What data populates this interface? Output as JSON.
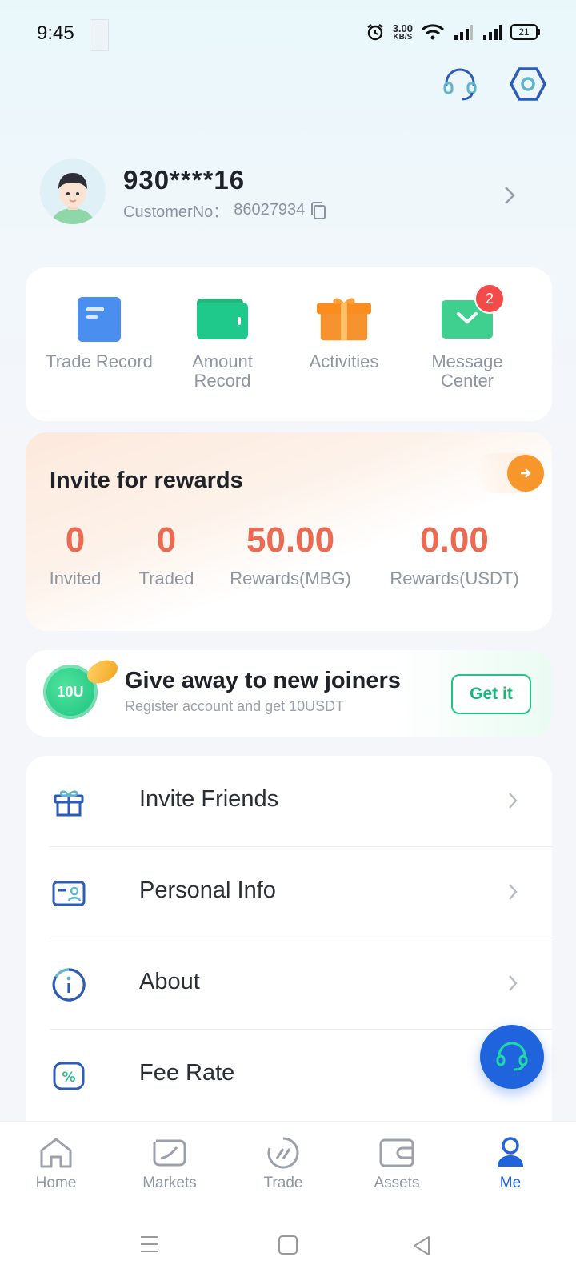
{
  "status_bar": {
    "time": "9:45",
    "net_speed_value": "3.00",
    "net_speed_unit": "KB/S",
    "battery": "21"
  },
  "header": {
    "support_icon": "headset-icon",
    "settings_icon": "hexagon-settings-icon"
  },
  "profile": {
    "username": "930****16",
    "customer_no_label": "CustomerNo：",
    "customer_no": "86027934"
  },
  "quick_actions": [
    {
      "label": "Trade Record",
      "icon": "document-icon",
      "color": "#4a8ff0"
    },
    {
      "label": "Amount Record",
      "icon": "wallet-icon",
      "color": "#1fc98b"
    },
    {
      "label": "Activities",
      "icon": "gift-icon",
      "color": "#f7932e"
    },
    {
      "label": "Message Center",
      "icon": "envelope-icon",
      "color": "#3fcf8e",
      "badge": "2"
    }
  ],
  "invite_rewards": {
    "title": "Invite for rewards",
    "stats": [
      {
        "value": "0",
        "label": "Invited"
      },
      {
        "value": "0",
        "label": "Traded"
      },
      {
        "value": "50.00",
        "label": "Rewards(MBG)"
      },
      {
        "value": "0.00",
        "label": "Rewards(USDT)"
      }
    ]
  },
  "new_joiners": {
    "coin_text": "10U",
    "title": "Give away to new joiners",
    "subtitle": "Register account  and get 10USDT",
    "button": "Get it"
  },
  "menu": [
    {
      "label": "Invite Friends",
      "icon": "gift-box-icon"
    },
    {
      "label": "Personal Info",
      "icon": "id-card-icon"
    },
    {
      "label": "About",
      "icon": "info-icon"
    },
    {
      "label": "Fee Rate",
      "icon": "percent-icon"
    }
  ],
  "bottom_nav": [
    {
      "label": "Home",
      "icon": "home-icon"
    },
    {
      "label": "Markets",
      "icon": "markets-icon"
    },
    {
      "label": "Trade",
      "icon": "trade-icon"
    },
    {
      "label": "Assets",
      "icon": "wallet-icon"
    },
    {
      "label": "Me",
      "icon": "person-icon",
      "active": true
    }
  ],
  "colors": {
    "accent": "#1f63dd",
    "reward_value": "#eb6a52",
    "green": "#22c486",
    "badge": "#f34a4a"
  }
}
